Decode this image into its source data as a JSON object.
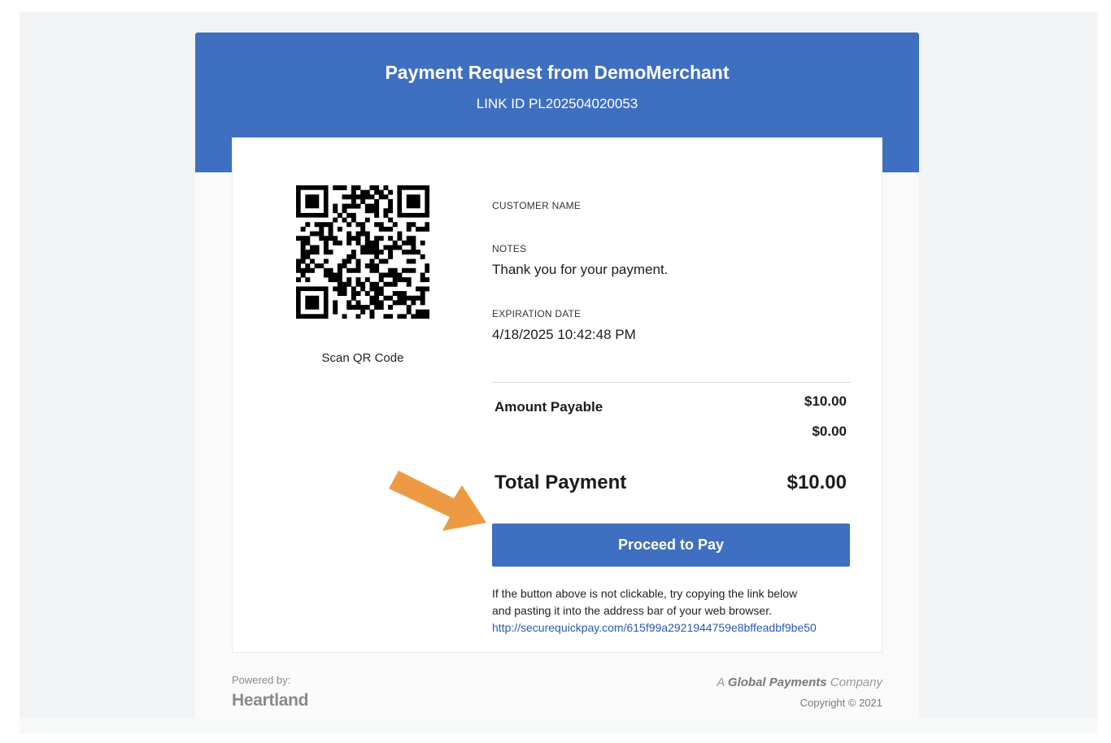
{
  "header": {
    "title": "Payment Request from DemoMerchant",
    "link_id": "LINK ID PL202504020053"
  },
  "qr": {
    "icon": "qr-code-icon",
    "label": "Scan QR Code"
  },
  "details": {
    "customer_name_label": "CUSTOMER NAME",
    "customer_name_value": "",
    "notes_label": "NOTES",
    "notes_value": "Thank you for your payment.",
    "expiration_label": "EXPIRATION DATE",
    "expiration_value": "4/18/2025 10:42:48 PM"
  },
  "amounts": {
    "amount_payable_label": "Amount Payable",
    "amount_payable_value": "$10.00",
    "secondary_value": "$0.00",
    "total_label": "Total Payment",
    "total_value": "$10.00"
  },
  "pay_button": {
    "label": "Proceed to Pay",
    "color": "#3f6fc1"
  },
  "help": {
    "line1": "If the button above is not clickable, try copying the link below",
    "line2": "and pasting it into the address bar of your web browser.",
    "link": "http://securequickpay.com/615f99a2921944759e8bffeadbf9be50"
  },
  "annotation": {
    "icon": "arrow-pointer-icon",
    "color": "#ee9a45"
  },
  "footer": {
    "powered_by": "Powered by:",
    "brand": "Heartland",
    "company_prefix": "A",
    "company_name": "Global Payments",
    "company_suffix": "Company",
    "copyright": "Copyright © 2021"
  },
  "colors": {
    "header_bg": "#3f6fc1",
    "link": "#2a58b5"
  }
}
